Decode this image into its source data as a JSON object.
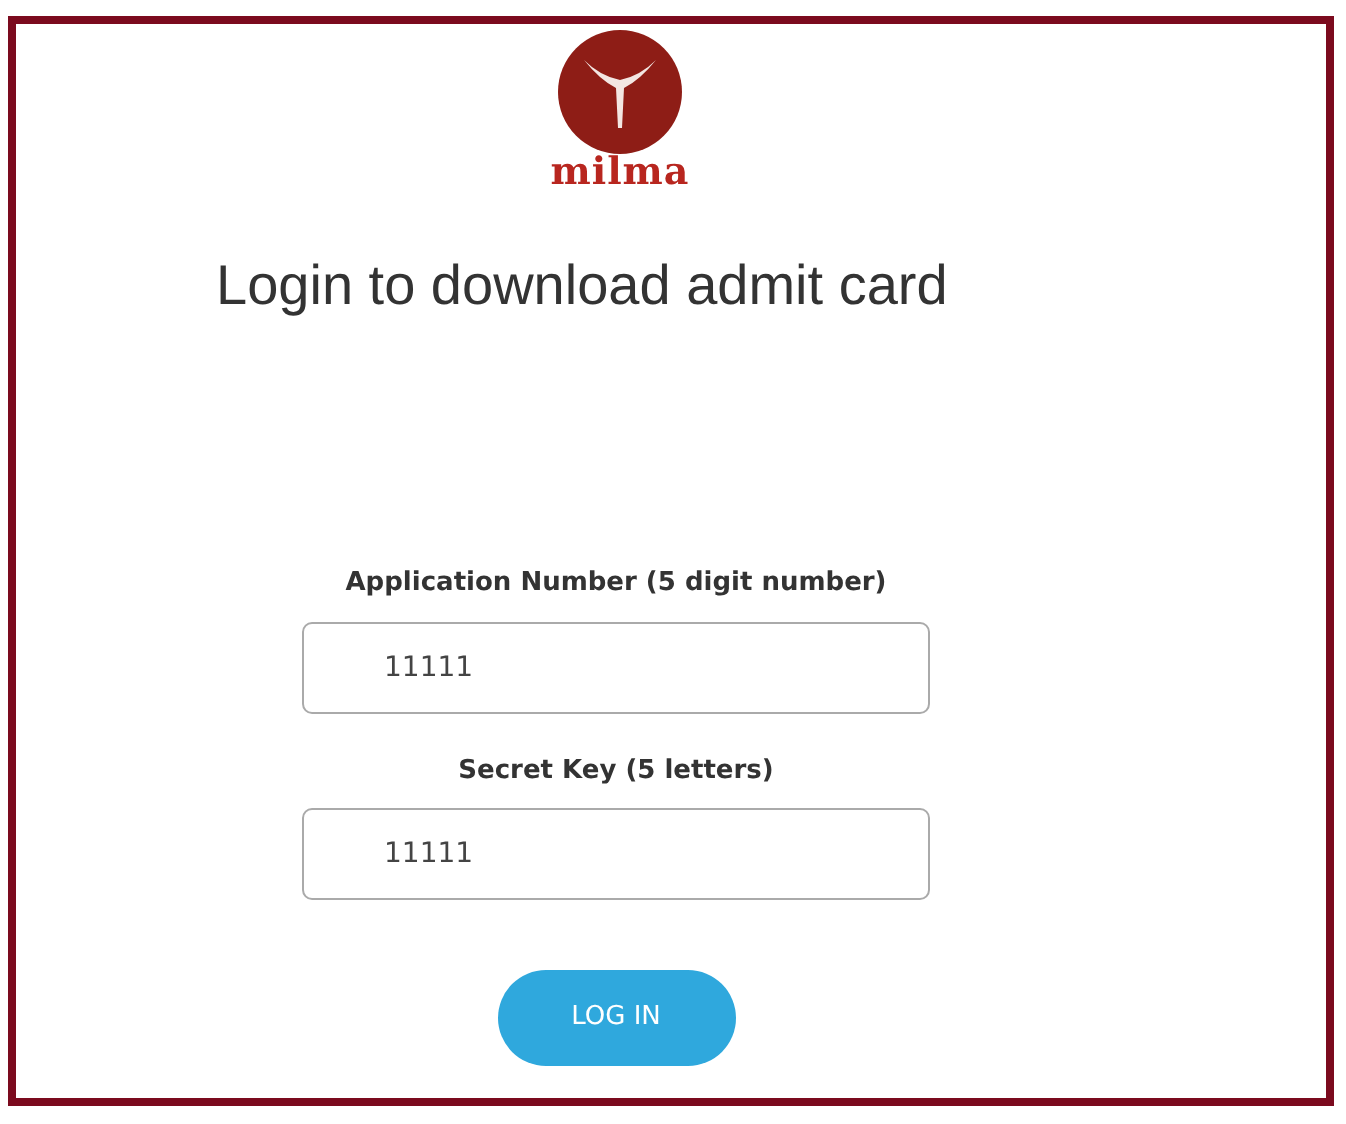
{
  "logo": {
    "text": "milma"
  },
  "title": "Login to download admit card",
  "fields": [
    {
      "label": "Application Number (5 digit number)",
      "value": "11111"
    },
    {
      "label": "Secret Key (5 letters)",
      "value": "11111"
    }
  ],
  "button": "LOG IN"
}
